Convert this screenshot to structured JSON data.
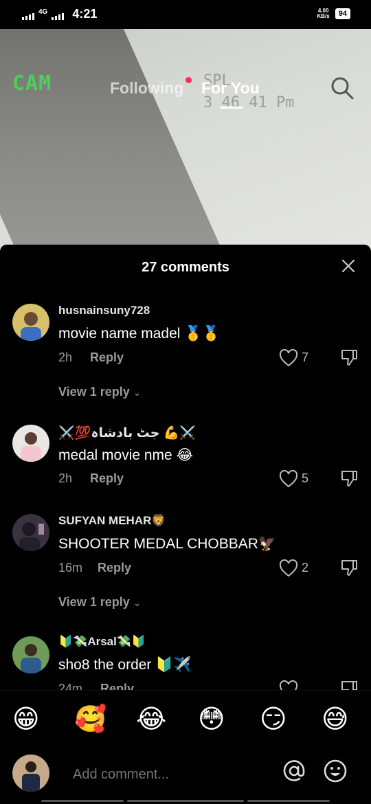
{
  "status_bar": {
    "network": "4G",
    "time": "4:21",
    "speed_value": "4.00",
    "speed_unit": "KB/s",
    "battery": "94"
  },
  "video": {
    "cam_label": "CAM",
    "cam_meta_line1": "SPL",
    "cam_meta_line2": "3 46 41 Pm"
  },
  "nav": {
    "following": "Following",
    "for_you": "For You"
  },
  "comments_panel": {
    "title": "27 comments",
    "comments": [
      {
        "username": "husnainsuny728",
        "text": "movie name madel 🥇🥇",
        "time": "2h",
        "reply": "Reply",
        "likes": "7",
        "view_replies": "View 1 reply"
      },
      {
        "username": "⚔️💯جٹ بادشاہ 💪⚔️",
        "text": "medal movie nme 😂",
        "time": "2h",
        "reply": "Reply",
        "likes": "5"
      },
      {
        "username": "SUFYAN  MEHAR🦁",
        "text": "SHOOTER MEDAL CHOBBAR🦅",
        "time": "16m",
        "reply": "Reply",
        "likes": "2",
        "view_replies": "View 1 reply"
      },
      {
        "username": "🔰💸Arsal💸🔰",
        "text": "sho8 the order 🔰✈️",
        "time": "24m",
        "reply": "Reply"
      }
    ]
  },
  "emoji_bar": [
    "😁",
    "🥰",
    "😂",
    "😳",
    "😏",
    "😅"
  ],
  "comment_input": {
    "placeholder": "Add comment..."
  },
  "colors": {
    "accent": "#fe2c55",
    "background": "#000000",
    "secondary_text": "#9a9a9a",
    "cam_green": "#4ccf5a"
  }
}
